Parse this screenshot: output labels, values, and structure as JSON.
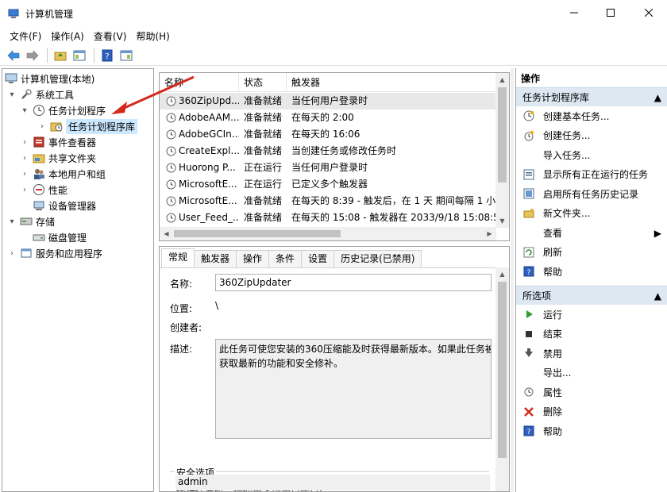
{
  "window": {
    "title": "计算机管理"
  },
  "menu": [
    "文件(F)",
    "操作(A)",
    "查看(V)",
    "帮助(H)"
  ],
  "tree": {
    "root": "计算机管理(本地)",
    "system_tools": "系统工具",
    "task_scheduler": "任务计划程序",
    "task_library": "任务计划程序库",
    "event_viewer": "事件查看器",
    "shared_folders": "共享文件夹",
    "local_users": "本地用户和组",
    "performance": "性能",
    "device_manager": "设备管理器",
    "storage": "存储",
    "disk_management": "磁盘管理",
    "services_apps": "服务和应用程序"
  },
  "list": {
    "columns": [
      "名称",
      "状态",
      "触发器"
    ],
    "rows": [
      {
        "name": "360ZipUpd...",
        "status": "准备就绪",
        "trigger": "当任何用户登录时"
      },
      {
        "name": "AdobeAAM...",
        "status": "准备就绪",
        "trigger": "在每天的 2:00"
      },
      {
        "name": "AdobeGCIn...",
        "status": "准备就绪",
        "trigger": "在每天的 16:06"
      },
      {
        "name": "CreateExpl...",
        "status": "准备就绪",
        "trigger": "当创建任务或修改任务时"
      },
      {
        "name": "Huorong P...",
        "status": "正在运行",
        "trigger": "当任何用户登录时"
      },
      {
        "name": "MicrosoftE...",
        "status": "正在运行",
        "trigger": "已定义多个触发器"
      },
      {
        "name": "MicrosoftE...",
        "status": "准备就绪",
        "trigger": "在每天的 8:39 - 触发后，在 1 天 期间每隔 1 小"
      },
      {
        "name": "User_Feed_...",
        "status": "准备就绪",
        "trigger": "在每天的 15:08 - 触发器在 2033/9/18 15:08:5"
      }
    ]
  },
  "detail": {
    "tabs": [
      "常规",
      "触发器",
      "操作",
      "条件",
      "设置",
      "历史记录(已禁用)"
    ],
    "name_label": "名称:",
    "name_value": "360ZipUpdater",
    "location_label": "位置:",
    "location_value": "\\",
    "author_label": "创建者:",
    "desc_label": "描述:",
    "desc_line1": "此任务可使您安装的360压缩能及时获得最新版本。如果此任务被",
    "desc_line2": "获取最新的功能和安全修补。",
    "security_title": "安全选项",
    "run_as_label": "运行任务时，请使用下列用户帐户:",
    "run_as_user": "admin"
  },
  "actions": {
    "header": "操作",
    "section1": "任务计划程序库",
    "items1": [
      "创建基本任务...",
      "创建任务...",
      "导入任务...",
      "显示所有正在运行的任务",
      "启用所有任务历史记录",
      "新文件夹...",
      "查看",
      "刷新",
      "帮助"
    ],
    "section2": "所选项",
    "items2": [
      "运行",
      "结束",
      "禁用",
      "导出...",
      "属性",
      "删除",
      "帮助"
    ]
  }
}
